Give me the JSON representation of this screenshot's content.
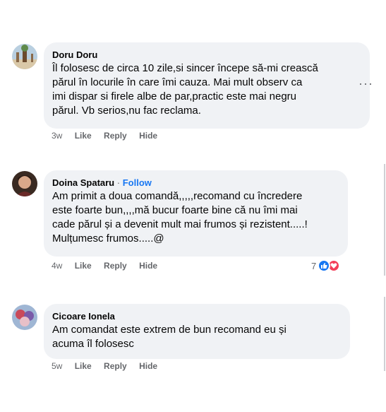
{
  "comments": [
    {
      "author": "Doru Doru",
      "follow": "",
      "text_lines": [
        "Îl folosesc de circa 10 zile,si sincer începe să-mi crească",
        "părul în locurile în care îmi cauza. Mai mult observ ca",
        "imi dispar si firele albe de par,practic este mai negru",
        "părul. Vb serios,nu fac reclama."
      ],
      "time": "3w",
      "like": "Like",
      "reply": "Reply",
      "hide": "Hide",
      "more_icon": "···"
    },
    {
      "author": "Doina Spataru",
      "separator": "·",
      "follow": "Follow",
      "text_lines": [
        "Am primit a doua comandă,,,,,recomand cu încredere",
        "este foarte bun,,,,mă bucur foarte bine că nu îmi mai",
        "cade părul și a devenit mult mai frumos și rezistent.....!",
        "Mulțumesc frumos.....@"
      ],
      "time": "4w",
      "like": "Like",
      "reply": "Reply",
      "hide": "Hide",
      "reaction_count": "7",
      "reaction_icons": [
        "like-icon",
        "love-icon"
      ]
    },
    {
      "author": "Cicoare Ionela",
      "follow": "",
      "text_lines": [
        "Am comandat este extrem de bun recomand eu și",
        "acuma îl folosesc"
      ],
      "time": "5w",
      "like": "Like",
      "reply": "Reply",
      "hide": "Hide"
    }
  ],
  "colors": {
    "bubble": "#f0f2f5",
    "meta": "#65676b",
    "follow": "#1877f2",
    "like_reaction": "#1877f2",
    "love_reaction": "#f33e58"
  }
}
